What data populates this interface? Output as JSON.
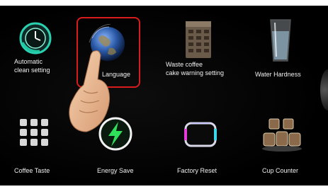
{
  "settings_menu": {
    "items": [
      {
        "key": "automatic-clean",
        "label_lines": [
          "Automatic",
          "clean setting"
        ],
        "icon": "clean-clock-icon"
      },
      {
        "key": "language",
        "label_lines": [
          "Language"
        ],
        "icon": "globe-icon",
        "selected": true
      },
      {
        "key": "waste-coffee",
        "label_lines": [
          "Waste coffee",
          "cake warning setting"
        ],
        "icon": "waste-bin-icon"
      },
      {
        "key": "water-hardness",
        "label_lines": [
          "Water Hardness"
        ],
        "icon": "water-glass-icon"
      },
      {
        "key": "coffee-taste",
        "label_lines": [
          "Coffee Taste"
        ],
        "icon": "grid-dots-icon"
      },
      {
        "key": "energy-save",
        "label_lines": [
          "Energy Save"
        ],
        "icon": "lightning-icon"
      },
      {
        "key": "factory-reset",
        "label_lines": [
          "Factory Reset"
        ],
        "icon": "reset-frame-icon"
      },
      {
        "key": "cup-counter",
        "label_lines": [
          "Cup Counter"
        ],
        "icon": "cups-icon"
      }
    ]
  },
  "pointer": {
    "icon": "hand-pointer-icon"
  },
  "colors": {
    "highlight": "#d81c1c",
    "background": "#000000",
    "label": "#f0f0f0"
  }
}
